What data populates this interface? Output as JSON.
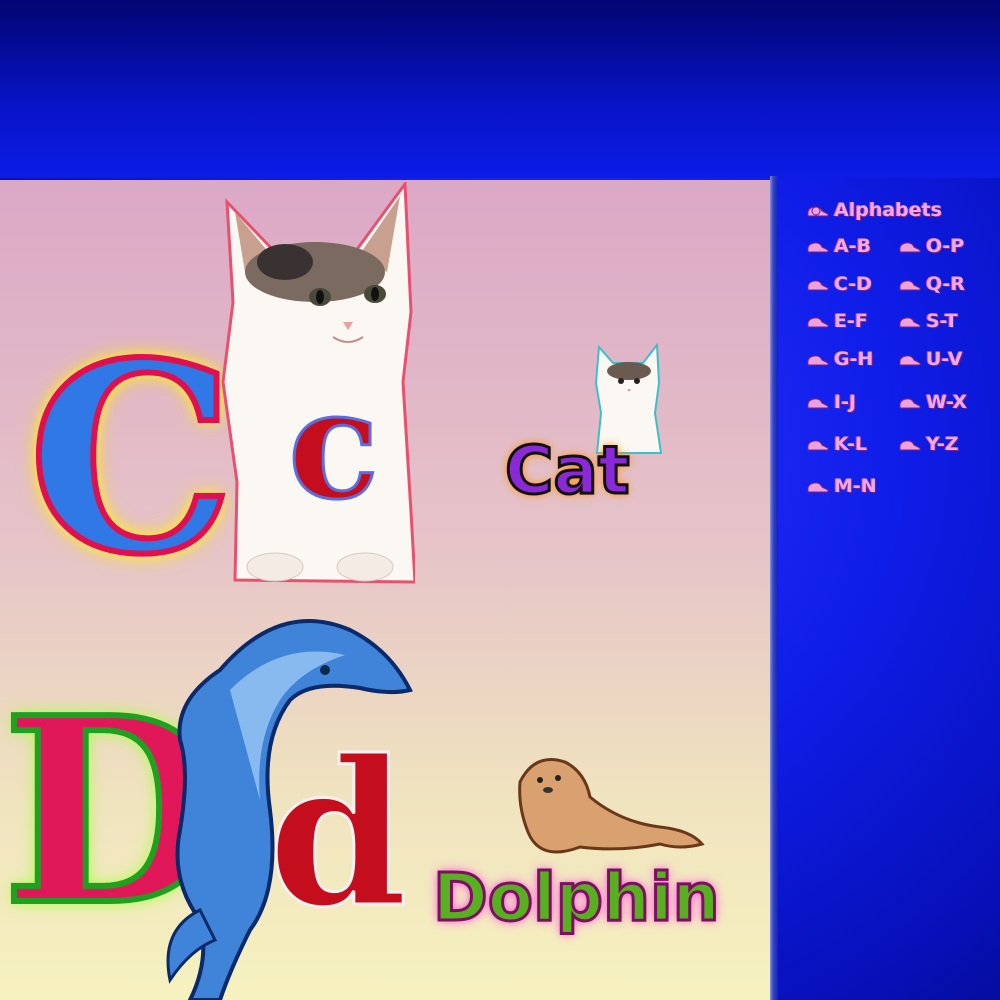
{
  "sidebar": {
    "title": "Alphabets",
    "links": [
      "A-B",
      "C-D",
      "E-F",
      "G-H",
      "I-J",
      "K-L",
      "M-N",
      "O-P",
      "Q-R",
      "S-T",
      "U-V",
      "W-X",
      "Y-Z"
    ]
  },
  "page": {
    "letter_c_upper": "C",
    "letter_c_lower": "c",
    "word_cat": "Cat",
    "letter_d_upper": "D",
    "letter_d_lower": "d",
    "word_dolphin": "Dolphin"
  },
  "icons": {
    "nav_bullet": "snail-icon",
    "kitten": "kitten-icon",
    "small_kitten": "small-kitten-icon",
    "dolphin": "dolphin-icon",
    "seal": "seal-icon"
  },
  "colors": {
    "nav_text": "#f3a7e0",
    "background_blue": "#0f1de8",
    "letter_c": "#2f78e6",
    "letter_d": "#e0185a",
    "lower_letter": "#c40e1e"
  }
}
